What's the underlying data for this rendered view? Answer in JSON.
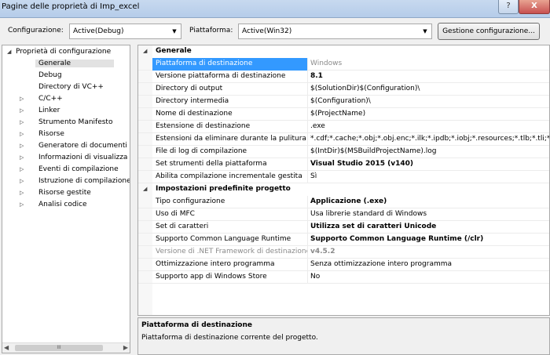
{
  "window": {
    "title": "Pagine delle proprietà di Imp_excel",
    "help": "?",
    "close": "X"
  },
  "toolbar": {
    "config_label": "Configurazione:",
    "config_value": "Active(Debug)",
    "platform_label": "Piattaforma:",
    "platform_value": "Active(Win32)",
    "manage_button": "Gestione configurazione..."
  },
  "tree": [
    {
      "label": "Proprietà di configurazione",
      "arrow": "◢",
      "level": 0
    },
    {
      "label": "Generale",
      "arrow": "",
      "level": 1,
      "selected": true
    },
    {
      "label": "Debug",
      "arrow": "",
      "level": 1
    },
    {
      "label": "Directory di VC++",
      "arrow": "",
      "level": 1
    },
    {
      "label": "C/C++",
      "arrow": "▷",
      "level": 1
    },
    {
      "label": "Linker",
      "arrow": "▷",
      "level": 1
    },
    {
      "label": "Strumento Manifesto",
      "arrow": "▷",
      "level": 1
    },
    {
      "label": "Risorse",
      "arrow": "▷",
      "level": 1
    },
    {
      "label": "Generatore di documenti X",
      "arrow": "▷",
      "level": 1
    },
    {
      "label": "Informazioni di visualizza",
      "arrow": "▷",
      "level": 1
    },
    {
      "label": "Eventi di compilazione",
      "arrow": "▷",
      "level": 1
    },
    {
      "label": "Istruzione di compilazione",
      "arrow": "▷",
      "level": 1
    },
    {
      "label": "Risorse gestite",
      "arrow": "▷",
      "level": 1
    },
    {
      "label": "Analisi codice",
      "arrow": "▷",
      "level": 1
    }
  ],
  "scroll": {
    "thumb": "III"
  },
  "grid": {
    "categories": {
      "general": "Generale",
      "defaults": "Impostazioni predefinite progetto"
    },
    "general_rows": [
      {
        "name": "Piattaforma di destinazione",
        "value": "Windows",
        "style": "gray",
        "selected": true
      },
      {
        "name": "Versione piattaforma di destinazione",
        "value": "8.1",
        "style": "b"
      },
      {
        "name": "Directory di output",
        "value": "$(SolutionDir)$(Configuration)\\",
        "style": ""
      },
      {
        "name": "Directory intermedia",
        "value": "$(Configuration)\\",
        "style": ""
      },
      {
        "name": "Nome di destinazione",
        "value": "$(ProjectName)",
        "style": ""
      },
      {
        "name": "Estensione di destinazione",
        "value": ".exe",
        "style": ""
      },
      {
        "name": "Estensioni da eliminare durante la pulitura",
        "value": "*.cdf;*.cache;*.obj;*.obj.enc;*.ilk;*.ipdb;*.iobj;*.resources;*.tlb;*.tli;*.t",
        "style": ""
      },
      {
        "name": "File di log di compilazione",
        "value": "$(IntDir)$(MSBuildProjectName).log",
        "style": ""
      },
      {
        "name": "Set strumenti della piattaforma",
        "value": "Visual Studio 2015 (v140)",
        "style": "b"
      },
      {
        "name": "Abilita compilazione incrementale gestita",
        "value": "Sì",
        "style": ""
      }
    ],
    "default_rows": [
      {
        "name": "Tipo configurazione",
        "value": "Applicazione (.exe)",
        "style": "b"
      },
      {
        "name": "Uso di MFC",
        "value": "Usa librerie standard di Windows",
        "style": ""
      },
      {
        "name": "Set di caratteri",
        "value": "Utilizza set di caratteri Unicode",
        "style": "b"
      },
      {
        "name": "Supporto Common Language Runtime",
        "value": "Supporto Common Language Runtime (/clr)",
        "style": "b"
      },
      {
        "name": "Versione di .NET Framework di destinazione",
        "value": "v4.5.2",
        "style": "gray-b",
        "name_gray": true
      },
      {
        "name": "Ottimizzazione intero programma",
        "value": "Senza ottimizzazione intero programma",
        "style": ""
      },
      {
        "name": "Supporto app di Windows Store",
        "value": "No",
        "style": ""
      }
    ]
  },
  "description": {
    "title": "Piattaforma di destinazione",
    "text": "Piattaforma di destinazione corrente del progetto."
  }
}
